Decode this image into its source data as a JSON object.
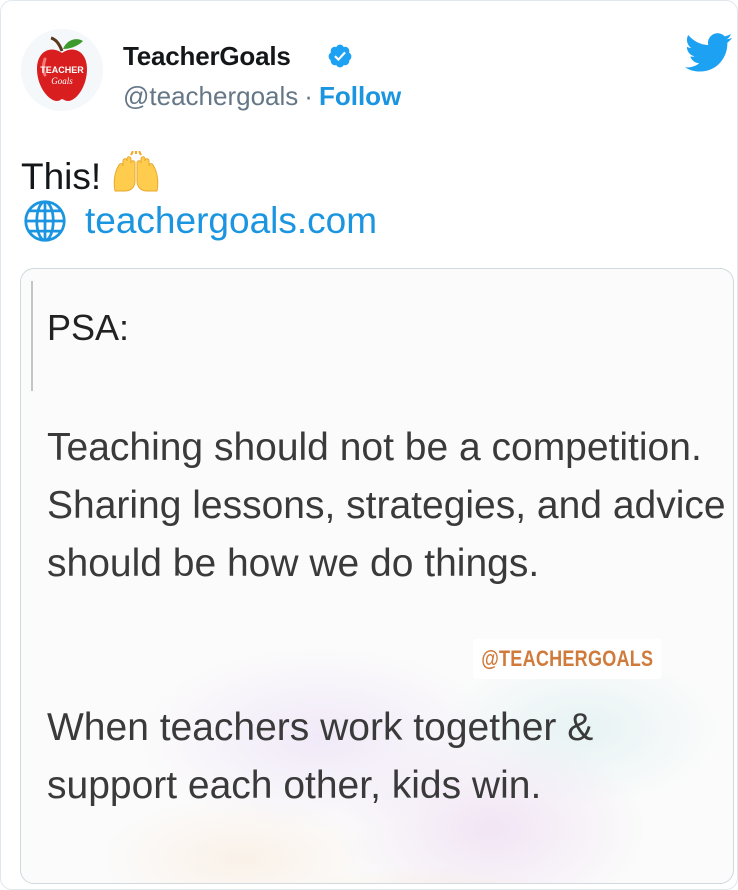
{
  "tweet": {
    "author": {
      "display_name": "TeacherGoals",
      "handle": "@teachergoals",
      "separator": "·",
      "follow_label": "Follow",
      "avatar_text_top": "TEACHER",
      "avatar_text_bottom": "Goals"
    },
    "text": "This!",
    "emoji": "🙌",
    "link": "teachergoals.com",
    "icons": {
      "verified": "verified-badge-icon",
      "brand": "twitter-bird-icon",
      "link": "globe-icon"
    },
    "colors": {
      "link": "#1b95e0",
      "handle": "#657786",
      "verified": "#1da1f2",
      "watermark": "#d07b3c"
    },
    "media": {
      "title": "PSA:",
      "paragraph1": "Teaching should not be a competition. Sharing lessons, strategies, and advice should be how we do things.",
      "watermark": "@TEACHERGOALS",
      "paragraph2": "When teachers work together & support each other, kids win."
    }
  }
}
